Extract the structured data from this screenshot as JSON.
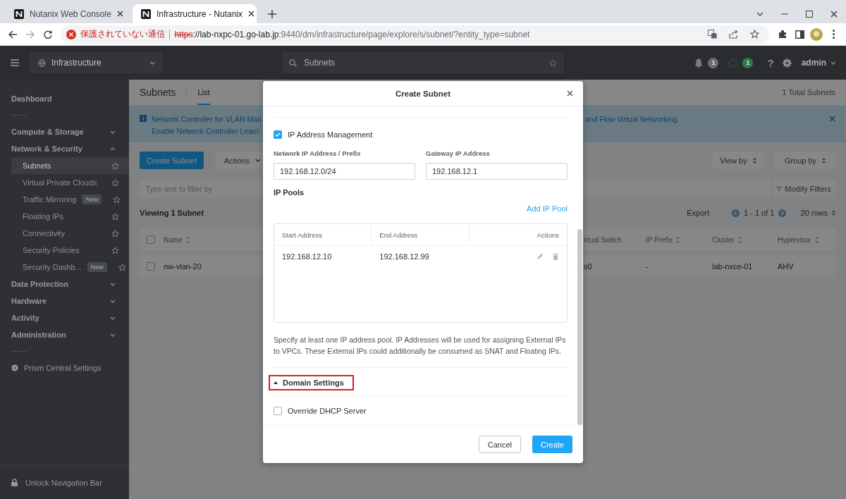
{
  "browser": {
    "tabs": [
      {
        "title": "Nutanix Web Console",
        "selected": false
      },
      {
        "title": "Infrastructure - Nutanix",
        "selected": true
      }
    ],
    "security_label": "保護されていない通信",
    "url_scheme": "https",
    "url_host": "://lab-nxpc-01.go-lab.jp",
    "url_path": ":9440/dm/infrastructure/page/explore/s/subnet/?entity_type=subnet"
  },
  "header": {
    "context": "Infrastructure",
    "search": "Subnets",
    "indicators": [
      {
        "kind": "alerts",
        "count": "1"
      },
      {
        "kind": "tasks",
        "count": "1"
      }
    ],
    "help": "?",
    "user": "admin"
  },
  "sidebar": {
    "dashboard": "Dashboard",
    "sections": [
      {
        "label": "Compute & Storage",
        "expanded": false
      },
      {
        "label": "Network & Security",
        "expanded": true,
        "children": [
          {
            "label": "Subnets",
            "selected": true
          },
          {
            "label": "Virtual Private Clouds",
            "selected": false
          },
          {
            "label": "Traffic Mirroring",
            "selected": false,
            "badge": "New"
          },
          {
            "label": "Floating IPs",
            "selected": false
          },
          {
            "label": "Connectivity",
            "selected": false
          },
          {
            "label": "Security Policies",
            "selected": false
          },
          {
            "label": "Security Dashb...",
            "selected": false,
            "badge": "New"
          }
        ]
      },
      {
        "label": "Data Protection",
        "expanded": false
      },
      {
        "label": "Hardware",
        "expanded": false
      },
      {
        "label": "Activity",
        "expanded": false
      },
      {
        "label": "Administration",
        "expanded": false
      }
    ],
    "settings": "Prism Central Settings",
    "unlock": "Unlock Navigation Bar"
  },
  "page": {
    "title": "Subnets",
    "tabs": [
      {
        "label": "List",
        "selected": true
      }
    ],
    "total": "1 Total Subnets",
    "banner": {
      "line_1": "Network Controller for VLAN Man",
      "line_2": "Enable Network Controller Learn",
      "tail": "and Flow Virtual Networking."
    },
    "toolbar": {
      "create": "Create Subnet",
      "actions": "Actions",
      "view_by": "View by",
      "group_by": "Group by"
    },
    "filter": {
      "placeholder": "Type text to filter by",
      "modify": "Modify Filters"
    },
    "viewing": "Viewing 1 Subnet",
    "export": "Export",
    "range": "1 - 1 of 1",
    "rows": "20 rows"
  },
  "table": {
    "all_selected": false,
    "columns": [
      {
        "label": "Name",
        "sortable": true
      },
      {
        "label": "irtual Switch",
        "sortable": false
      },
      {
        "label": "IP Prefix",
        "sortable": true
      },
      {
        "label": "Cluster",
        "sortable": true
      },
      {
        "label": "Hypervisor",
        "sortable": true
      }
    ],
    "rows": [
      {
        "selected": false,
        "cells": [
          "nw-vlan-20",
          "s0",
          "-",
          "lab-nxce-01",
          "AHV"
        ]
      }
    ]
  },
  "dialog": {
    "title": "Create Subnet",
    "ipam": {
      "label": "IP Address Management",
      "checked": true
    },
    "fields": [
      {
        "label": "Network IP Address / Prefix",
        "value": "192.168.12.0/24"
      },
      {
        "label": "Gateway IP Address",
        "value": "192.168.12.1"
      }
    ],
    "pools_title": "IP Pools",
    "add_pool": "Add IP Pool",
    "pool_columns": [
      "Start Address",
      "End Address",
      "Actions"
    ],
    "pools": [
      {
        "start": "192.168.12.10",
        "end": "192.168.12.99"
      }
    ],
    "help": "Specify at least one IP address pool. IP Addresses will be used for assigning External IPs to VPCs. These External IPs could additionally be consumed as SNAT and Floating IPs.",
    "domain": {
      "label": "Domain Settings",
      "expanded": true,
      "highlighted": true
    },
    "override": {
      "label": "Override DHCP Server",
      "checked": false
    },
    "buttons": [
      {
        "label": "Cancel",
        "kind": "secondary"
      },
      {
        "label": "Create",
        "kind": "primary"
      }
    ]
  }
}
